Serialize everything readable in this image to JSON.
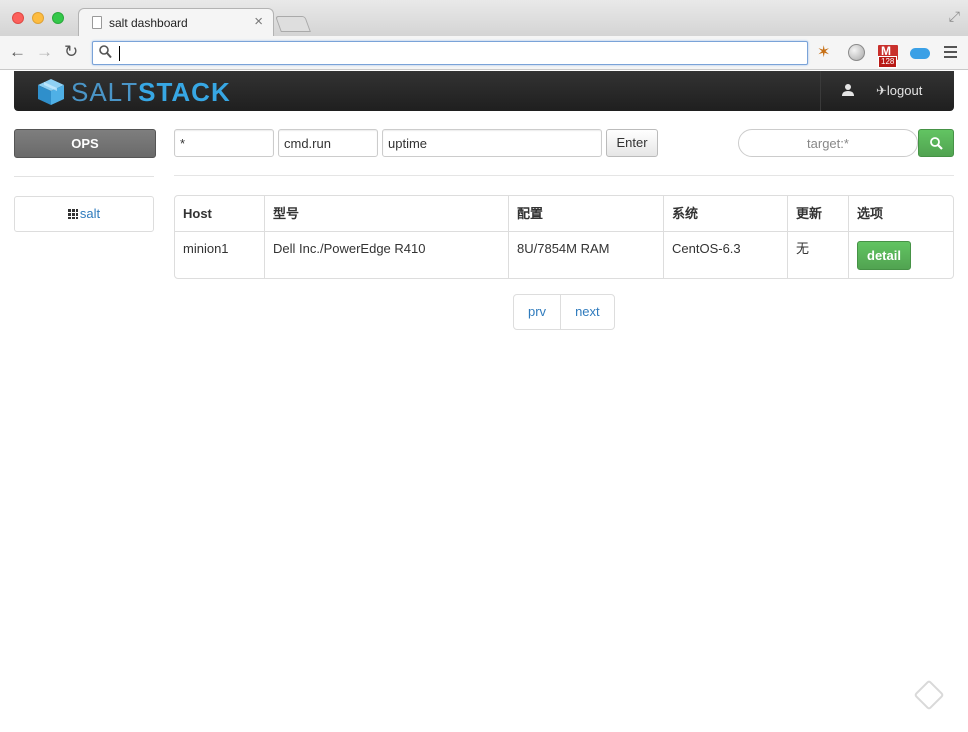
{
  "browser": {
    "tab_title": "salt dashboard",
    "tab_close": "×",
    "url": "",
    "gmail_badge": "128"
  },
  "brand": {
    "salt": "SALT",
    "stack": "STACK"
  },
  "navbar": {
    "logout_label": "logout"
  },
  "sidebar": {
    "ops_label": "OPS",
    "items": [
      {
        "label": "salt"
      }
    ]
  },
  "command": {
    "target_value": "*",
    "function_value": "cmd.run",
    "args_value": "uptime",
    "enter_label": "Enter",
    "search_placeholder": "target:*"
  },
  "table": {
    "headers": [
      "Host",
      "型号",
      "配置",
      "系统",
      "更新",
      "选项"
    ],
    "rows": [
      {
        "host": "minion1",
        "model": "Dell Inc./PowerEdge R410",
        "config": "8U/7854M RAM",
        "system": "CentOS-6.3",
        "update": "无",
        "action_label": "detail"
      }
    ]
  },
  "pager": {
    "prev_label": "prv",
    "next_label": "next"
  },
  "colors": {
    "brand_blue": "#37a7e4",
    "success_green": "#51a351",
    "link_blue": "#2f7bbd",
    "navbar_dark": "#222222"
  }
}
